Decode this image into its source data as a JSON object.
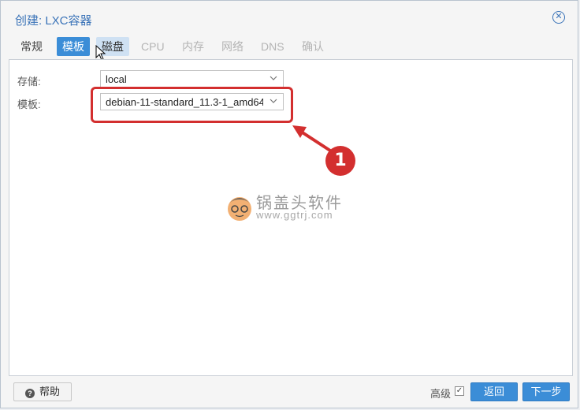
{
  "window": {
    "title": "创建: LXC容器",
    "close_icon": "close-circle-icon"
  },
  "tabs": [
    {
      "label": "常规",
      "state": "normal"
    },
    {
      "label": "模板",
      "state": "active"
    },
    {
      "label": "磁盘",
      "state": "hover"
    },
    {
      "label": "CPU",
      "state": "disabled"
    },
    {
      "label": "内存",
      "state": "disabled"
    },
    {
      "label": "网络",
      "state": "disabled"
    },
    {
      "label": "DNS",
      "state": "disabled"
    },
    {
      "label": "确认",
      "state": "disabled"
    }
  ],
  "form": {
    "storage": {
      "label": "存储:",
      "value": "local"
    },
    "template": {
      "label": "模板:",
      "value": "debian-11-standard_11.3-1_amd64"
    }
  },
  "annotation": {
    "number": "1",
    "color": "#d32f2f"
  },
  "watermark": {
    "line1": "锅盖头软件",
    "line2": "www.ggtrj.com"
  },
  "footer": {
    "help_label": "帮助",
    "advanced_label": "高级",
    "advanced_checked": true,
    "back_label": "返回",
    "next_label": "下一步"
  },
  "colors": {
    "accent": "#3b8dd7",
    "title": "#3a73b8",
    "annotation": "#d32f2f"
  }
}
